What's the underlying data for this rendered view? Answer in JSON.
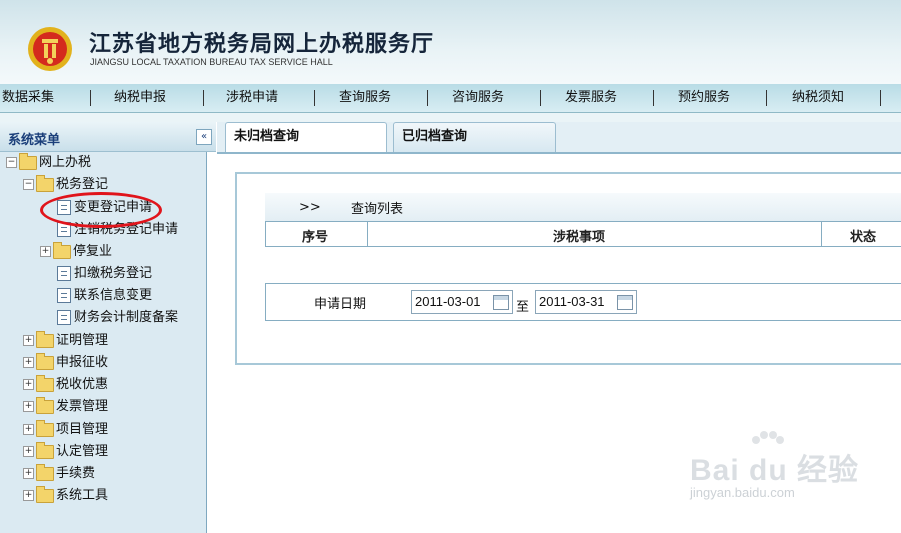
{
  "header": {
    "title_cn": "江苏省地方税务局网上办税服务厅",
    "title_en": "JIANGSU LOCAL TAXATION BUREAU TAX SERVICE HALL"
  },
  "nav": {
    "items": [
      "数据采集",
      "纳税申报",
      "涉税申请",
      "查询服务",
      "咨询服务",
      "发票服务",
      "预约服务",
      "纳税须知"
    ]
  },
  "sidebar": {
    "title": "系统菜单",
    "collapse_glyph": "«",
    "tree": {
      "root": "网上办税",
      "group": "税务登记",
      "items": [
        "变更登记申请",
        "注销税务登记申请",
        "停复业",
        "扣缴税务登记",
        "联系信息变更",
        "财务会计制度备案"
      ],
      "folders": [
        "证明管理",
        "申报征收",
        "税收优惠",
        "发票管理",
        "项目管理",
        "认定管理",
        "手续费",
        "系统工具"
      ]
    }
  },
  "tabs": [
    "未归档查询",
    "已归档查询"
  ],
  "list": {
    "arrow": ">>",
    "title": "查询列表",
    "columns": [
      "序号",
      "涉税事项",
      "状态"
    ]
  },
  "date_filter": {
    "label": "申请日期",
    "start": "2011-03-01",
    "to": "至",
    "end": "2011-03-31"
  },
  "watermark": {
    "brand": "Bai du 经验",
    "site": "jingyan.baidu.com"
  },
  "colors": {
    "accent": "#1b3f7a",
    "highlight": "#e0141b"
  }
}
